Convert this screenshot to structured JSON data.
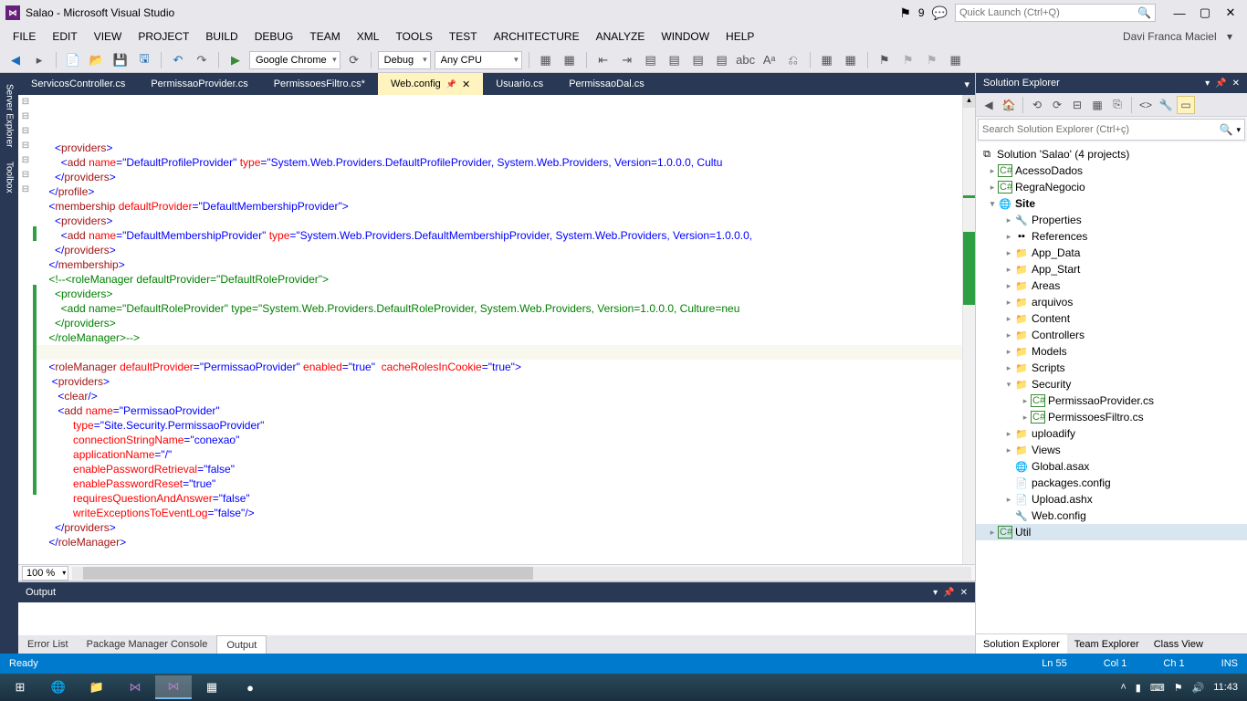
{
  "title": "Salao - Microsoft Visual Studio",
  "notif_count": "9",
  "quicklaunch_placeholder": "Quick Launch (Ctrl+Q)",
  "user": "Davi Franca Maciel",
  "menu": [
    "FILE",
    "EDIT",
    "VIEW",
    "PROJECT",
    "BUILD",
    "DEBUG",
    "TEAM",
    "XML",
    "TOOLS",
    "TEST",
    "ARCHITECTURE",
    "ANALYZE",
    "WINDOW",
    "HELP"
  ],
  "toolbar": {
    "browser": "Google Chrome",
    "config": "Debug",
    "platform": "Any CPU"
  },
  "left_rail": [
    "Server Explorer",
    "Toolbox"
  ],
  "tabs": [
    {
      "label": "ServicosController.cs",
      "active": false
    },
    {
      "label": "PermissaoProvider.cs",
      "active": false
    },
    {
      "label": "PermissoesFiltro.cs*",
      "active": false
    },
    {
      "label": "Web.config",
      "active": true,
      "pinned": true
    },
    {
      "label": "Usuario.cs",
      "active": false
    },
    {
      "label": "PermissaoDal.cs",
      "active": false
    }
  ],
  "zoom": "100 %",
  "output": {
    "title": "Output",
    "tabs": [
      "Error List",
      "Package Manager Console",
      "Output"
    ],
    "active": 2
  },
  "solution_explorer": {
    "title": "Solution Explorer",
    "search_placeholder": "Search Solution Explorer (Ctrl+ç)",
    "root": "Solution 'Salao' (4 projects)",
    "projects": [
      "AcessoDados",
      "RegraNegocio"
    ],
    "site": "Site",
    "site_children": [
      "Properties",
      "References",
      "App_Data",
      "App_Start",
      "Areas",
      "arquivos",
      "Content",
      "Controllers",
      "Models",
      "Scripts"
    ],
    "security": "Security",
    "security_files": [
      "PermissaoProvider.cs",
      "PermissoesFiltro.cs"
    ],
    "site_rest": [
      "uploadify",
      "Views"
    ],
    "site_files": [
      "Global.asax",
      "packages.config",
      "Upload.ashx",
      "Web.config"
    ],
    "util": "Util",
    "tabs": [
      "Solution Explorer",
      "Team Explorer",
      "Class View"
    ]
  },
  "status": {
    "ready": "Ready",
    "ln": "Ln 55",
    "col": "Col 1",
    "ch": "Ch 1",
    "ins": "INS"
  },
  "clock": "11:43"
}
